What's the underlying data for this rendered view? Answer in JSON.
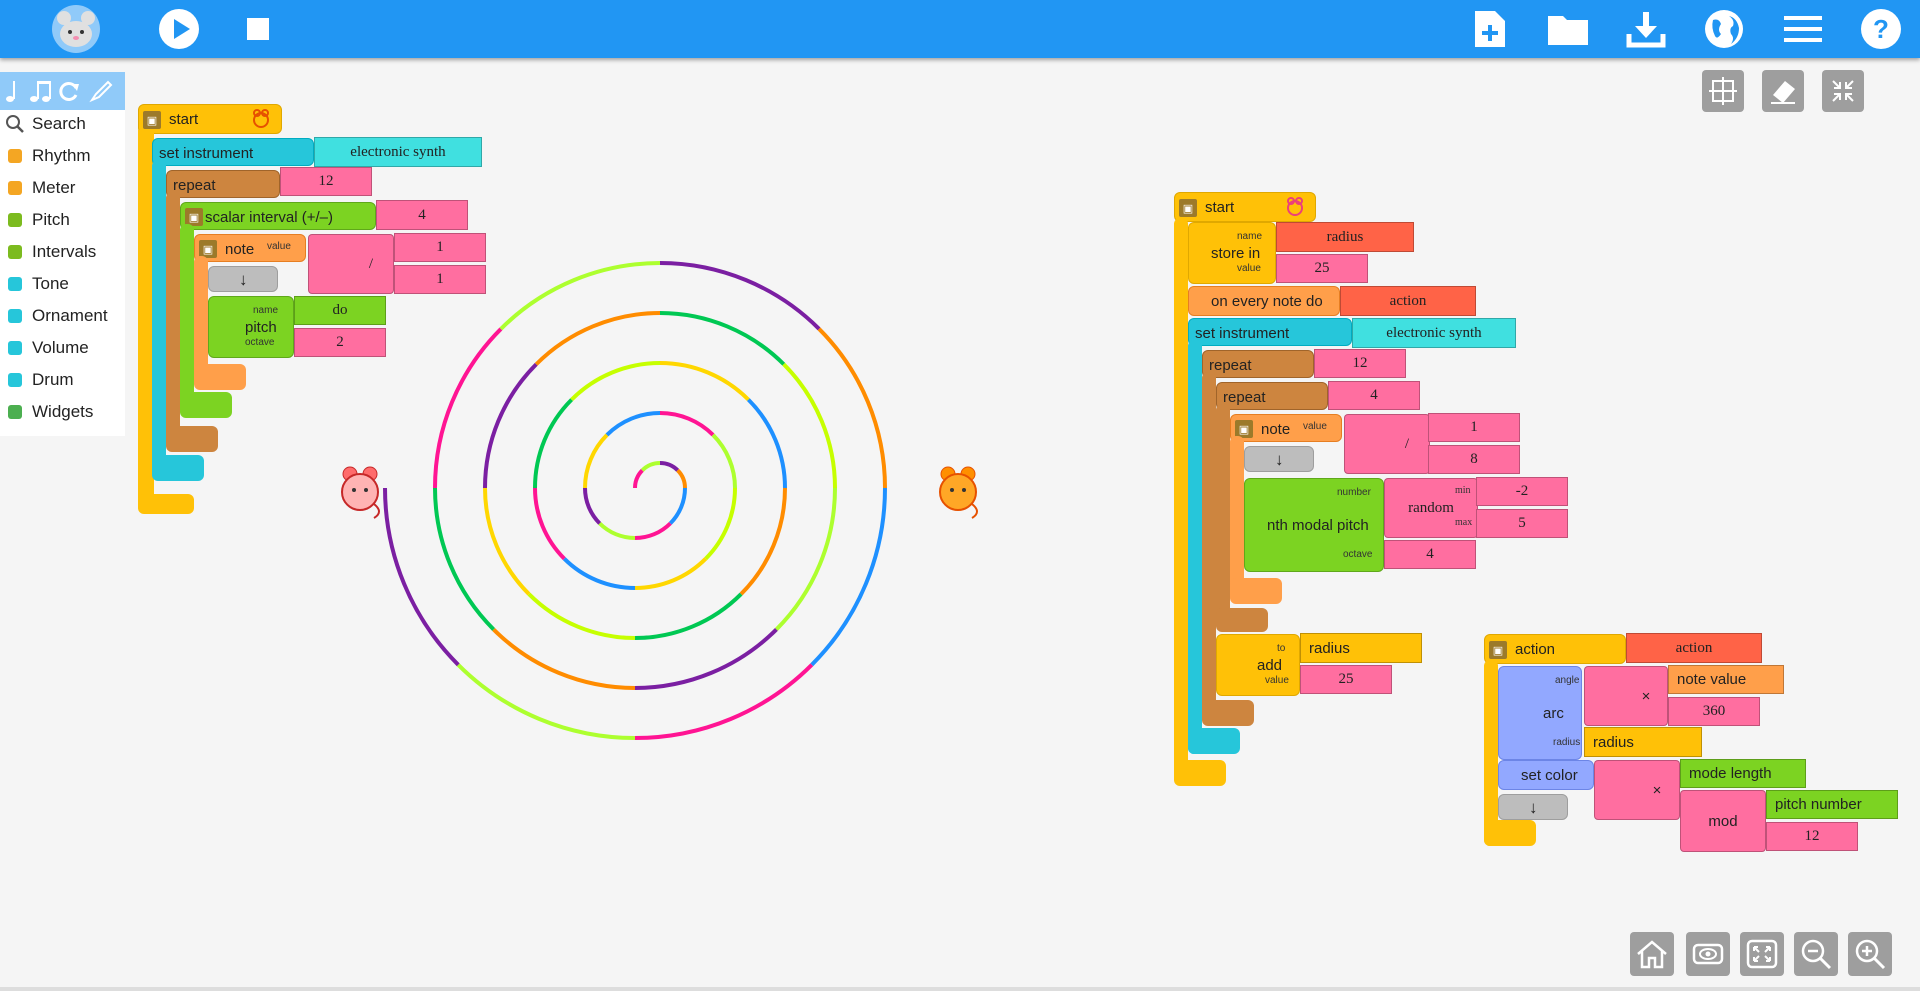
{
  "toolbar": {
    "logo_icon": "mouse-logo-icon",
    "left": [
      "play-icon",
      "stop-icon"
    ],
    "right": [
      "new-project-icon",
      "open-folder-icon",
      "download-icon",
      "language-globe-icon",
      "menu-icon",
      "help-icon"
    ]
  },
  "palette": {
    "head_icons": [
      "notes-icon",
      "notes-icon",
      "refresh-icon",
      "pen-icon"
    ],
    "items": [
      {
        "label": "Search",
        "icon": "search-icon",
        "color": "#555555"
      },
      {
        "label": "Rhythm",
        "icon": "rhythm-icon",
        "color": "#f4a623"
      },
      {
        "label": "Meter",
        "icon": "meter-icon",
        "color": "#f4a623"
      },
      {
        "label": "Pitch",
        "icon": "pitch-icon",
        "color": "#7cbb1f"
      },
      {
        "label": "Intervals",
        "icon": "intervals-icon",
        "color": "#7cbb1f"
      },
      {
        "label": "Tone",
        "icon": "tone-icon",
        "color": "#26c6da"
      },
      {
        "label": "Ornament",
        "icon": "ornament-icon",
        "color": "#26c6da"
      },
      {
        "label": "Volume",
        "icon": "volume-icon",
        "color": "#26c6da"
      },
      {
        "label": "Drum",
        "icon": "drum-icon",
        "color": "#26c6da"
      },
      {
        "label": "Widgets",
        "icon": "widgets-icon",
        "color": "#4caf50"
      }
    ]
  },
  "stack1": {
    "start": "start",
    "set_instrument": "set instrument",
    "instrument": "electronic synth",
    "repeat": "repeat",
    "repeat_count": "12",
    "scalar_interval": "scalar interval (+/–)",
    "interval_value": "4",
    "note": "note",
    "value_label": "value",
    "divide": "/",
    "numerator": "1",
    "denominator": "1",
    "pitch": "pitch",
    "name_label": "name",
    "octave_label": "octave",
    "pitch_name": "do",
    "octave": "2"
  },
  "stack2": {
    "start": "start",
    "store_in": "store in",
    "name_label": "name",
    "value_label": "value",
    "var_name": "radius",
    "var_value": "25",
    "on_every_note_do": "on every note do",
    "action_name": "action",
    "set_instrument": "set instrument",
    "instrument": "electronic synth",
    "repeat": "repeat",
    "repeat_outer": "12",
    "repeat_inner": "4",
    "note": "note",
    "divide": "/",
    "numerator": "1",
    "denominator": "8",
    "nth_modal_pitch": "nth modal pitch",
    "number_label": "number",
    "random": "random",
    "min_label": "min",
    "max_label": "max",
    "min": "-2",
    "max": "5",
    "octave_label": "octave",
    "octave": "4",
    "add": "add",
    "to_label": "to",
    "add_to": "radius",
    "add_value": "25"
  },
  "stack3": {
    "action": "action",
    "action_name": "action",
    "arc": "arc",
    "angle_label": "angle",
    "radius_label": "radius",
    "multiply": "×",
    "note_value": "note value",
    "degrees": "360",
    "radius": "radius",
    "set_color": "set color",
    "mode_length": "mode length",
    "mod": "mod",
    "pitch_number": "pitch number",
    "modulus": "12"
  },
  "colors": {
    "topbar": "#2196f3",
    "start_block": "#ffc107",
    "instrument_block": "#26c6da",
    "repeat_block": "#cd853f",
    "number_arg": "#ff6ea0",
    "pitch_block": "#7cd322",
    "note_block": "#ff9f4a",
    "action_block": "#ffc107",
    "var_arg": "#ff6347",
    "arc_block": "#92a8ff"
  },
  "spiral_colors": [
    "#ff1493",
    "#ff8c00",
    "#ffd700",
    "#adff2f",
    "#00c853",
    "#1e90ff",
    "#7b1fa2",
    "#c6ff00"
  ]
}
